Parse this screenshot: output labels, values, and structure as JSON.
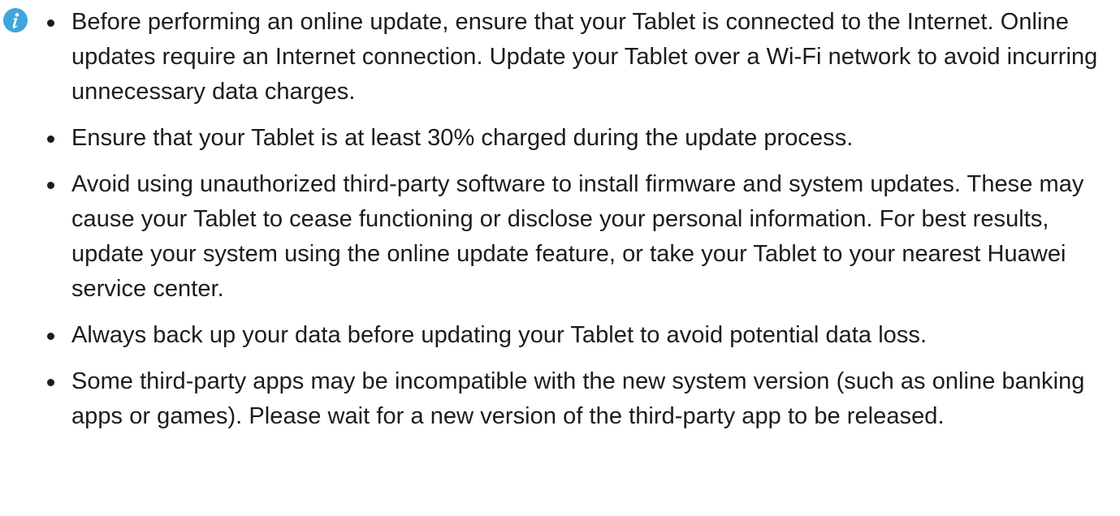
{
  "note": {
    "icon": "info-icon",
    "icon_color": "#3ea6dd",
    "items": [
      {
        "text": "Before performing an online update, ensure that your Tablet is connected to the Internet. Online updates require an Internet connection. Update your Tablet over a Wi-Fi network to avoid incurring unnecessary data charges."
      },
      {
        "text": "Ensure that your Tablet is at least 30% charged during the update process."
      },
      {
        "text": "Avoid using unauthorized third-party software to install firmware and system updates. These may cause your Tablet to cease functioning or disclose your personal information. For best results, update your system using the online update feature, or take your Tablet to your nearest Huawei service center."
      },
      {
        "text": "Always back up your data before updating your Tablet to avoid potential data loss."
      },
      {
        "text": "Some third-party apps may be incompatible with the new system version (such as online banking apps or games). Please wait for a new version of the third-party app to be released."
      }
    ]
  }
}
